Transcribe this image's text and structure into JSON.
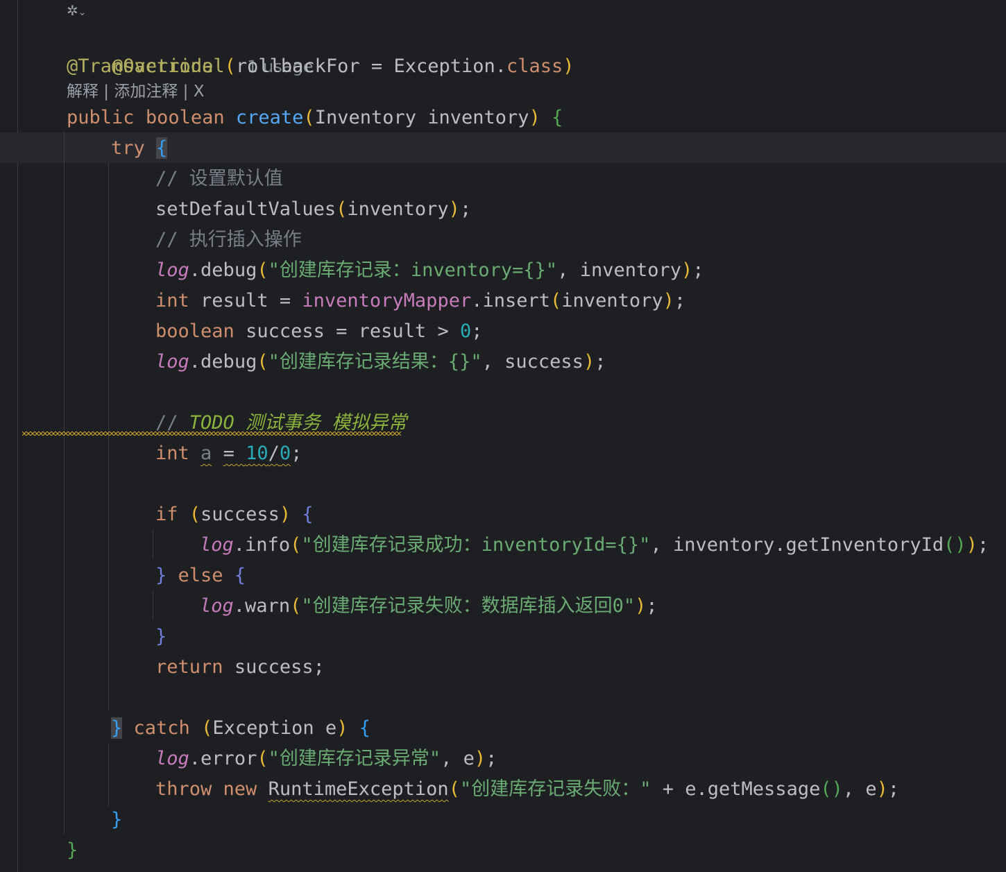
{
  "editor": {
    "ai_icon": "ai-assistant-icon",
    "ai_chevron": "chevron-down-icon",
    "usage_hint": "1 usage",
    "code_lens": {
      "explain": "解释",
      "separator1": " | ",
      "add_comment": "添加注释",
      "separator2": " | ",
      "close": "X"
    },
    "tokens": {
      "override": "@Override",
      "transactional": "@Transactional",
      "rollback_arg": "rollbackFor",
      "exception_class": "Exception",
      "class_kw": "class",
      "public_kw": "public",
      "boolean_kw": "boolean",
      "method_name": "create",
      "param_type": "Inventory",
      "param_name": "inventory",
      "try_kw": "try",
      "comment_defaults": "// 设置默认值",
      "set_defaults_call": "setDefaultValues",
      "comment_insert": "// 执行插入操作",
      "log": "log",
      "debug": "debug",
      "str_create_record": "\"创建库存记录：inventory={}\"",
      "int_kw": "int",
      "result_var": "result",
      "mapper_field": "inventoryMapper",
      "insert_call": "insert",
      "success_var": "success",
      "zero": "0",
      "str_create_result": "\"创建库存记录结果：{}\"",
      "todo_comment_slashes": "//",
      "todo_comment_text": "TODO 测试事务 模拟异常",
      "a_var": "a",
      "ten": "10",
      "if_kw": "if",
      "info": "info",
      "str_success": "\"创建库存记录成功：inventoryId={}\"",
      "get_inventory_id": "getInventoryId",
      "else_kw": "else",
      "warn": "warn",
      "str_failed_zero": "\"创建库存记录失败：数据库插入返回0\"",
      "return_kw": "return",
      "catch_kw": "catch",
      "exception_type": "Exception",
      "e_var": "e",
      "error": "error",
      "str_exception": "\"创建库存记录异常\"",
      "throw_kw": "throw",
      "new_kw": "new",
      "runtime_exception": "RuntimeException",
      "str_failed": "\"创建库存记录失败：\"",
      "get_message": "getMessage"
    }
  },
  "colors": {
    "background": "#1e1f22",
    "keyword": "#cf8e6d",
    "annotation": "#b3ae60",
    "function": "#56a8f5",
    "string": "#6aab73",
    "number": "#2aacb8",
    "comment": "#7a7e85",
    "field": "#c77dbb",
    "warning_wave": "#c9a531"
  }
}
